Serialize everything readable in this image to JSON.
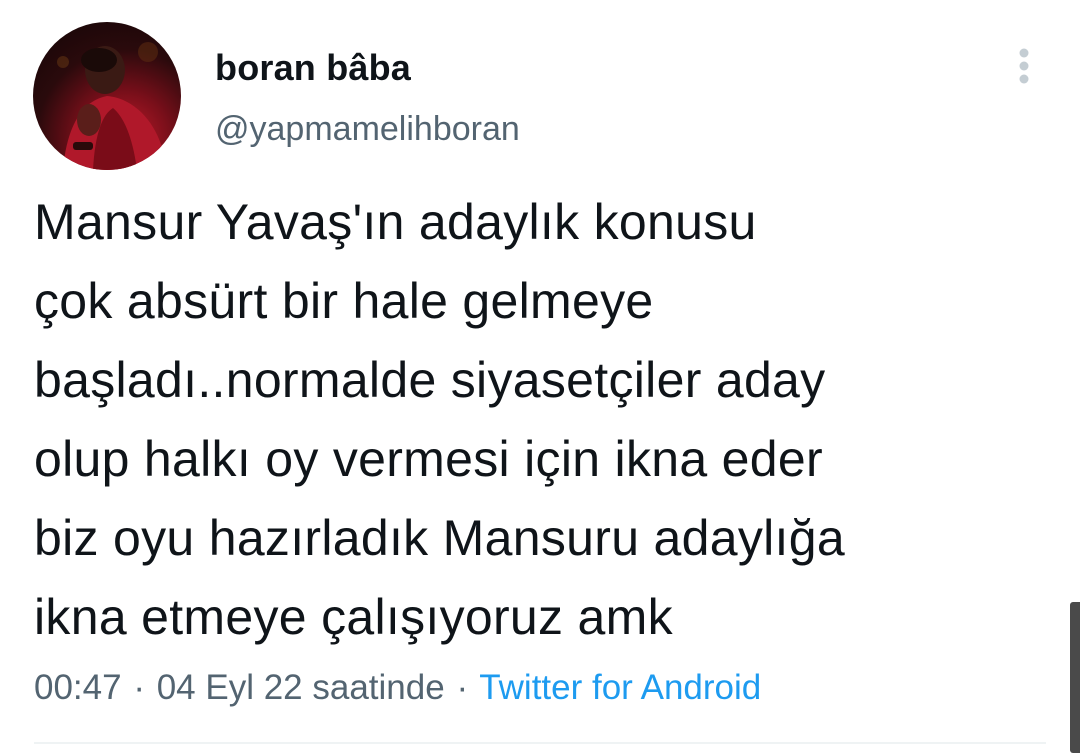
{
  "tweet": {
    "author": {
      "display_name": "boran bâba",
      "handle": "@yapmamelihboran"
    },
    "text": "Mansur Yavaş'ın adaylık konusu\nçok absürt bir hale gelmeye\nbaşladı..normalde siyasetçiler aday\nolup halkı oy vermesi için ikna eder\nbiz oyu hazırladık Mansuru adaylığa\nikna etmeye çalışıyoruz amk",
    "time": "00:47",
    "date": "04 Eyl 22 saatinde",
    "separator": "·",
    "source": "Twitter for Android"
  },
  "icons": {
    "more": "vertical-ellipsis-icon"
  },
  "colors": {
    "text_primary": "#0f1419",
    "text_secondary": "#536471",
    "link": "#1d9bf0",
    "divider": "#eff3f4",
    "more_icon": "#c4cdd3"
  }
}
